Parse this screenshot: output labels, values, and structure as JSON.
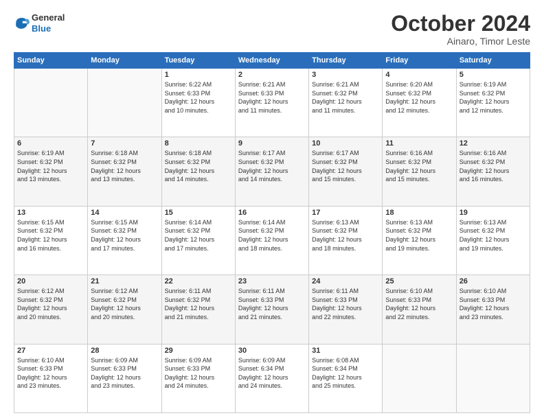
{
  "header": {
    "logo": {
      "general": "General",
      "blue": "Blue"
    },
    "month_year": "October 2024",
    "location": "Ainaro, Timor Leste"
  },
  "weekdays": [
    "Sunday",
    "Monday",
    "Tuesday",
    "Wednesday",
    "Thursday",
    "Friday",
    "Saturday"
  ],
  "weeks": [
    [
      {
        "day": "",
        "info": ""
      },
      {
        "day": "",
        "info": ""
      },
      {
        "day": "1",
        "info": "Sunrise: 6:22 AM\nSunset: 6:33 PM\nDaylight: 12 hours\nand 10 minutes."
      },
      {
        "day": "2",
        "info": "Sunrise: 6:21 AM\nSunset: 6:33 PM\nDaylight: 12 hours\nand 11 minutes."
      },
      {
        "day": "3",
        "info": "Sunrise: 6:21 AM\nSunset: 6:32 PM\nDaylight: 12 hours\nand 11 minutes."
      },
      {
        "day": "4",
        "info": "Sunrise: 6:20 AM\nSunset: 6:32 PM\nDaylight: 12 hours\nand 12 minutes."
      },
      {
        "day": "5",
        "info": "Sunrise: 6:19 AM\nSunset: 6:32 PM\nDaylight: 12 hours\nand 12 minutes."
      }
    ],
    [
      {
        "day": "6",
        "info": "Sunrise: 6:19 AM\nSunset: 6:32 PM\nDaylight: 12 hours\nand 13 minutes."
      },
      {
        "day": "7",
        "info": "Sunrise: 6:18 AM\nSunset: 6:32 PM\nDaylight: 12 hours\nand 13 minutes."
      },
      {
        "day": "8",
        "info": "Sunrise: 6:18 AM\nSunset: 6:32 PM\nDaylight: 12 hours\nand 14 minutes."
      },
      {
        "day": "9",
        "info": "Sunrise: 6:17 AM\nSunset: 6:32 PM\nDaylight: 12 hours\nand 14 minutes."
      },
      {
        "day": "10",
        "info": "Sunrise: 6:17 AM\nSunset: 6:32 PM\nDaylight: 12 hours\nand 15 minutes."
      },
      {
        "day": "11",
        "info": "Sunrise: 6:16 AM\nSunset: 6:32 PM\nDaylight: 12 hours\nand 15 minutes."
      },
      {
        "day": "12",
        "info": "Sunrise: 6:16 AM\nSunset: 6:32 PM\nDaylight: 12 hours\nand 16 minutes."
      }
    ],
    [
      {
        "day": "13",
        "info": "Sunrise: 6:15 AM\nSunset: 6:32 PM\nDaylight: 12 hours\nand 16 minutes."
      },
      {
        "day": "14",
        "info": "Sunrise: 6:15 AM\nSunset: 6:32 PM\nDaylight: 12 hours\nand 17 minutes."
      },
      {
        "day": "15",
        "info": "Sunrise: 6:14 AM\nSunset: 6:32 PM\nDaylight: 12 hours\nand 17 minutes."
      },
      {
        "day": "16",
        "info": "Sunrise: 6:14 AM\nSunset: 6:32 PM\nDaylight: 12 hours\nand 18 minutes."
      },
      {
        "day": "17",
        "info": "Sunrise: 6:13 AM\nSunset: 6:32 PM\nDaylight: 12 hours\nand 18 minutes."
      },
      {
        "day": "18",
        "info": "Sunrise: 6:13 AM\nSunset: 6:32 PM\nDaylight: 12 hours\nand 19 minutes."
      },
      {
        "day": "19",
        "info": "Sunrise: 6:13 AM\nSunset: 6:32 PM\nDaylight: 12 hours\nand 19 minutes."
      }
    ],
    [
      {
        "day": "20",
        "info": "Sunrise: 6:12 AM\nSunset: 6:32 PM\nDaylight: 12 hours\nand 20 minutes."
      },
      {
        "day": "21",
        "info": "Sunrise: 6:12 AM\nSunset: 6:32 PM\nDaylight: 12 hours\nand 20 minutes."
      },
      {
        "day": "22",
        "info": "Sunrise: 6:11 AM\nSunset: 6:32 PM\nDaylight: 12 hours\nand 21 minutes."
      },
      {
        "day": "23",
        "info": "Sunrise: 6:11 AM\nSunset: 6:33 PM\nDaylight: 12 hours\nand 21 minutes."
      },
      {
        "day": "24",
        "info": "Sunrise: 6:11 AM\nSunset: 6:33 PM\nDaylight: 12 hours\nand 22 minutes."
      },
      {
        "day": "25",
        "info": "Sunrise: 6:10 AM\nSunset: 6:33 PM\nDaylight: 12 hours\nand 22 minutes."
      },
      {
        "day": "26",
        "info": "Sunrise: 6:10 AM\nSunset: 6:33 PM\nDaylight: 12 hours\nand 23 minutes."
      }
    ],
    [
      {
        "day": "27",
        "info": "Sunrise: 6:10 AM\nSunset: 6:33 PM\nDaylight: 12 hours\nand 23 minutes."
      },
      {
        "day": "28",
        "info": "Sunrise: 6:09 AM\nSunset: 6:33 PM\nDaylight: 12 hours\nand 23 minutes."
      },
      {
        "day": "29",
        "info": "Sunrise: 6:09 AM\nSunset: 6:33 PM\nDaylight: 12 hours\nand 24 minutes."
      },
      {
        "day": "30",
        "info": "Sunrise: 6:09 AM\nSunset: 6:34 PM\nDaylight: 12 hours\nand 24 minutes."
      },
      {
        "day": "31",
        "info": "Sunrise: 6:08 AM\nSunset: 6:34 PM\nDaylight: 12 hours\nand 25 minutes."
      },
      {
        "day": "",
        "info": ""
      },
      {
        "day": "",
        "info": ""
      }
    ]
  ]
}
